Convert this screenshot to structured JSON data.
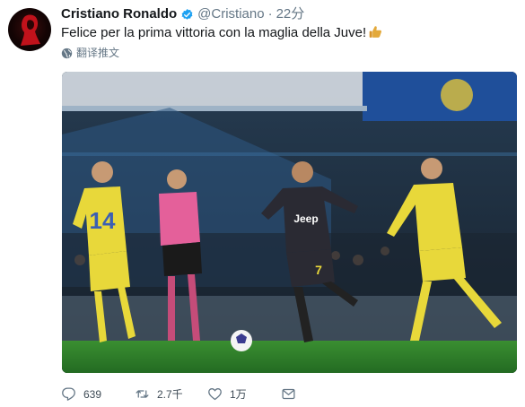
{
  "tweet": {
    "author_name": "Cristiano Ronaldo",
    "handle": "@Cristiano",
    "separator": "·",
    "time": "22分",
    "text": "Felice per la prima vittoria con la maglia della Juve!",
    "translate_label": "翻译推文",
    "verified": true
  },
  "photo": {
    "kit_numbers": {
      "left_player": "14",
      "dark_player": "7"
    },
    "shirt_sponsor": "Jeep"
  },
  "actions": {
    "reply": {
      "icon": "reply-icon",
      "count": "639"
    },
    "retweet": {
      "icon": "retweet-icon",
      "count": "2.7千"
    },
    "like": {
      "icon": "heart-icon",
      "count": "1万"
    },
    "message": {
      "icon": "envelope-icon"
    }
  },
  "colors": {
    "link_blue": "#1da1f2",
    "muted_gray": "#657786",
    "text": "#14171a",
    "pitch_green": "#2f7d2b",
    "chievo_yellow": "#e8d83a",
    "juve_dark": "#2a2a33"
  }
}
